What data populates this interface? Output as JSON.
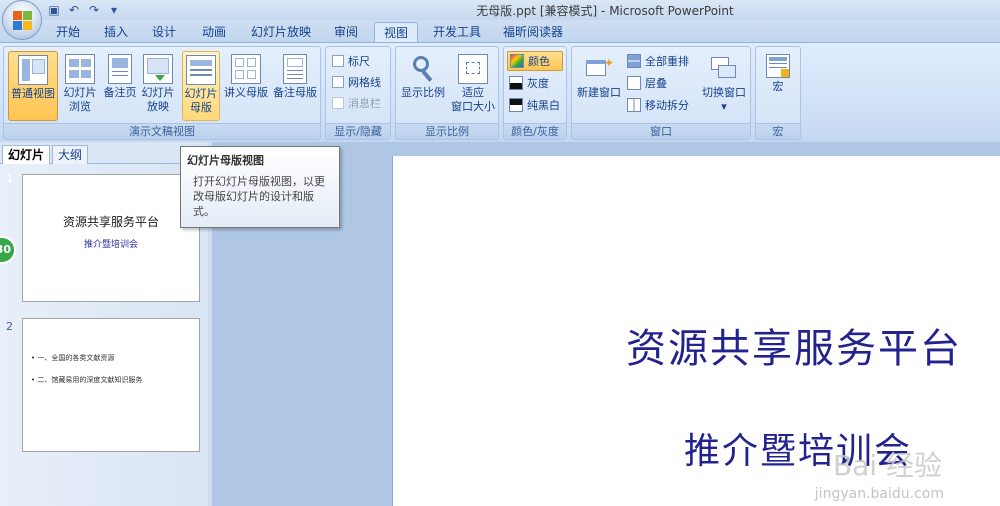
{
  "window": {
    "title": "无母版.ppt [兼容模式] - Microsoft PowerPoint"
  },
  "quick_access": {
    "icons": [
      "save-icon",
      "undo-icon",
      "redo-icon",
      "customize-icon"
    ]
  },
  "tabs": [
    "开始",
    "插入",
    "设计",
    "动画",
    "幻灯片放映",
    "审阅",
    "视图",
    "开发工具",
    "福昕阅读器"
  ],
  "active_tab": "视图",
  "ribbon": {
    "presentation_views": {
      "label": "演示文稿视图",
      "normal": "普通视图",
      "sorter_1": "幻灯片",
      "sorter_2": "浏览",
      "notes": "备注页",
      "show_1": "幻灯片",
      "show_2": "放映",
      "master_1": "幻灯片",
      "master_2": "母版",
      "handout_master": "讲义母版",
      "notes_master": "备注母版"
    },
    "show_hide": {
      "label": "显示/隐藏",
      "ruler": "标尺",
      "gridlines": "网格线",
      "message_bar": "消息栏"
    },
    "zoom": {
      "label": "显示比例",
      "zoom": "显示比例",
      "fit_1": "适应",
      "fit_2": "窗口大小"
    },
    "color": {
      "label": "颜色/灰度",
      "color": "颜色",
      "grayscale": "灰度",
      "bw": "纯黑白"
    },
    "window": {
      "label": "窗口",
      "new_window": "新建窗口",
      "arrange_all": "全部重排",
      "cascade": "层叠",
      "move_split": "移动拆分",
      "switch": "切换窗口",
      "switch_arrow": "▾"
    },
    "macro": {
      "label": "宏",
      "macro": "宏"
    }
  },
  "tooltip": {
    "title": "幻灯片母版视图",
    "body": "打开幻灯片母版视图，以更改母版幻灯片的设计和版式。"
  },
  "pane": {
    "tab_slides": "幻灯片",
    "tab_outline": "大纲",
    "close": "×",
    "slide1": {
      "num": "1",
      "title": "资源共享服务平台",
      "subtitle": "推介暨培训会"
    },
    "slide2": {
      "num": "2",
      "line1": "•  一、全国的各类文献资源",
      "line2": "•  二、馆藏易用的深度文献知识服务"
    }
  },
  "badge": "30",
  "slide": {
    "title": "资源共享服务平台",
    "subtitle": "推介暨培训会"
  },
  "watermark": {
    "text": "Bai 经验",
    "url": "jingyan.baidu.com"
  }
}
